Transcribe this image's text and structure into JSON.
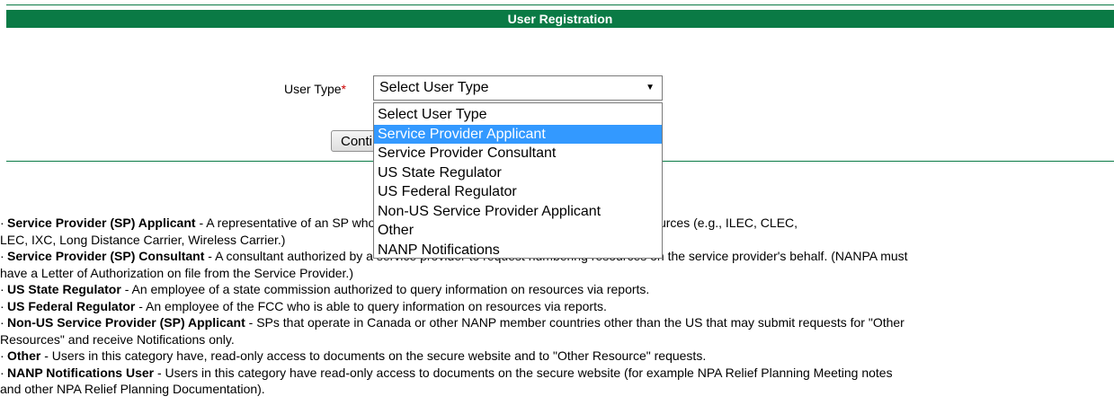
{
  "header": {
    "title": "User Registration"
  },
  "form": {
    "user_type_label": "User Type",
    "required_marker": "*",
    "select_value": "Select User Type",
    "continue_label": "Continue"
  },
  "dropdown": {
    "options": [
      "Select User Type",
      "Service Provider Applicant",
      "Service Provider Consultant",
      "US State Regulator",
      "US Federal Regulator",
      "Non-US Service Provider Applicant",
      "Other",
      "NANP Notifications"
    ],
    "highlighted_index": 1
  },
  "descriptions": [
    {
      "term": "Service Provider (SP) Applicant",
      "line1": " - A representative of an SP who will request assignments of NANP numbering resources (e.g., ILEC, CLEC,",
      "line2": "LEC, IXC, Long Distance Carrier, Wireless Carrier.)"
    },
    {
      "term": "Service Provider (SP) Consultant",
      "line1": " - A consultant authorized by a service provider to request numbering resources on the service provider's behalf. (NANPA must",
      "line2": "have a Letter of Authorization on file from the Service Provider.)"
    },
    {
      "term": "US State Regulator",
      "line1": " - An employee of a state commission authorized to query information on resources via reports.",
      "line2": ""
    },
    {
      "term": "US Federal Regulator",
      "line1": " - An employee of the FCC who is able to query information on resources via reports.",
      "line2": ""
    },
    {
      "term": "Non-US Service Provider (SP) Applicant",
      "line1": " - SPs that operate in Canada or other NANP member countries other than the US that may submit requests for \"Other",
      "line2": "Resources\" and receive Notifications only."
    },
    {
      "term": "Other",
      "line1": " - Users in this category have, read-only access to documents on the secure website and to \"Other Resource\" requests.",
      "line2": ""
    },
    {
      "term": "NANP Notifications User",
      "line1": " - Users in this category have read-only access to documents on the secure website (for example NPA Relief Planning Meeting notes",
      "line2": "and other NPA Relief Planning Documentation)."
    }
  ],
  "colors": {
    "header_green": "#0a7a45",
    "highlight_blue": "#3399ff",
    "required_red": "#cc0000"
  }
}
